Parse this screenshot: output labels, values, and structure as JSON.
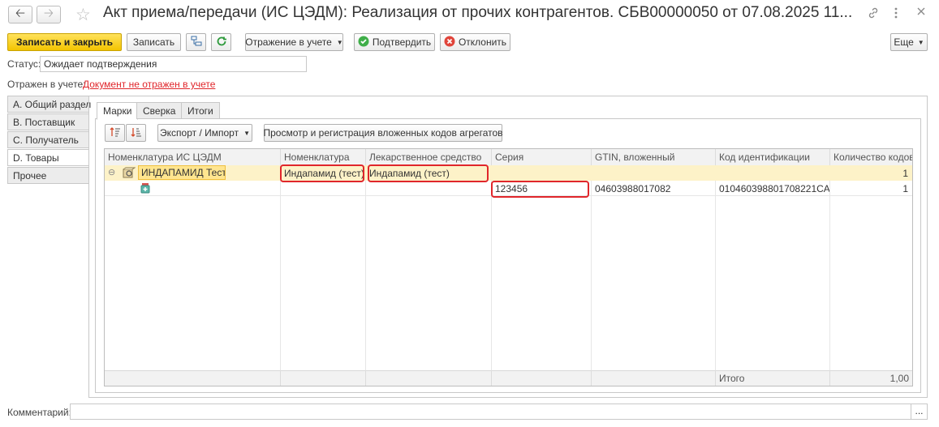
{
  "window": {
    "title": "Акт приема/передачи (ИС ЦЭДМ): Реализация от прочих контрагентов.  СБВ00000050 от 07.08.2025 11...",
    "back_icon": "arrow-left-icon",
    "forward_icon": "arrow-right-icon",
    "star_icon": "star-icon",
    "link_icon": "link-icon",
    "more_icon": "more-vertical-icon",
    "close_icon": "close-icon"
  },
  "toolbar": {
    "save_close": "Записать и закрыть",
    "save": "Записать",
    "reflection": "Отражение в учете",
    "confirm": "Подтвердить",
    "reject": "Отклонить",
    "more": "Еще"
  },
  "status": {
    "label": "Статус:",
    "value": "Ожидает подтверждения"
  },
  "reflected": {
    "label": "Отражен в учете:",
    "link": "Документ не отражен в учете"
  },
  "left_tabs": [
    {
      "label": "A. Общий раздел"
    },
    {
      "label": "B. Поставщик"
    },
    {
      "label": "C. Получатель"
    },
    {
      "label": "D. Товары"
    },
    {
      "label": "Прочее"
    }
  ],
  "inner_tabs": [
    {
      "label": "Марки"
    },
    {
      "label": "Сверка"
    },
    {
      "label": "Итоги"
    }
  ],
  "grid_toolbar": {
    "export_import": "Экспорт / Импорт",
    "view_register": "Просмотр и регистрация вложенных кодов агрегатов"
  },
  "table": {
    "columns": [
      "Номенклатура ИС ЦЭДМ",
      "Номенклатура",
      "Лекарственное средство",
      "Серия",
      "GTIN, вложенный",
      "Код идентификации",
      "Количество кодов"
    ],
    "rows": [
      [
        "ИНДАПАМИД Тест",
        "Индапамид (тест)",
        "Индапамид (тест)",
        "",
        "",
        "",
        "1"
      ],
      [
        "",
        "",
        "",
        "123456",
        "04603988017082",
        "010460398801708221CA...",
        "1"
      ]
    ],
    "footer": {
      "label": "Итого",
      "value": "1,00"
    }
  },
  "comment": {
    "label": "Комментарий:",
    "value": "",
    "button": "..."
  },
  "colors": {
    "primary_button": "#f3c400",
    "highlight_row": "#fdf2c8",
    "link": "#e0262b",
    "annotation": "#e0262b"
  }
}
